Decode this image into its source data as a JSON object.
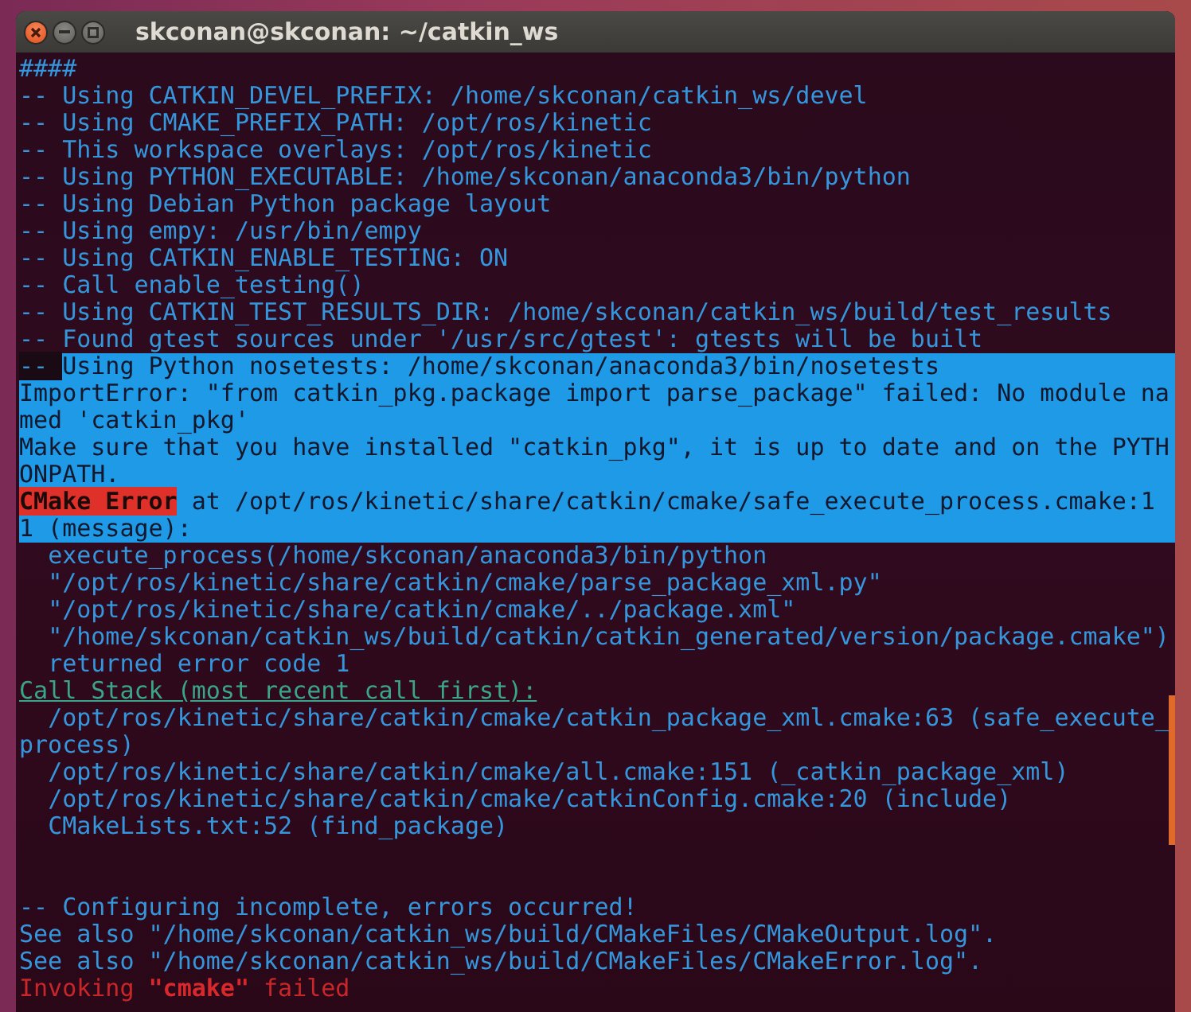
{
  "window": {
    "title": "skconan@skconan: ~/catkin_ws"
  },
  "lines": [
    {
      "selected": false,
      "segments": [
        {
          "text": "####",
          "kind": "info"
        }
      ]
    },
    {
      "selected": false,
      "segments": [
        {
          "text": "-- Using CATKIN_DEVEL_PREFIX: /home/skconan/catkin_ws/devel",
          "kind": "info"
        }
      ]
    },
    {
      "selected": false,
      "segments": [
        {
          "text": "-- Using CMAKE_PREFIX_PATH: /opt/ros/kinetic",
          "kind": "info"
        }
      ]
    },
    {
      "selected": false,
      "segments": [
        {
          "text": "-- This workspace overlays: /opt/ros/kinetic",
          "kind": "info"
        }
      ]
    },
    {
      "selected": false,
      "segments": [
        {
          "text": "-- Using PYTHON_EXECUTABLE: /home/skconan/anaconda3/bin/python",
          "kind": "info"
        }
      ]
    },
    {
      "selected": false,
      "segments": [
        {
          "text": "-- Using Debian Python package layout",
          "kind": "info"
        }
      ]
    },
    {
      "selected": false,
      "segments": [
        {
          "text": "-- Using empy: /usr/bin/empy",
          "kind": "info"
        }
      ]
    },
    {
      "selected": false,
      "segments": [
        {
          "text": "-- Using CATKIN_ENABLE_TESTING: ON",
          "kind": "info"
        }
      ]
    },
    {
      "selected": false,
      "segments": [
        {
          "text": "-- Call enable_testing()",
          "kind": "info"
        }
      ]
    },
    {
      "selected": false,
      "segments": [
        {
          "text": "-- Using CATKIN_TEST_RESULTS_DIR: /home/skconan/catkin_ws/build/test_results",
          "kind": "info"
        }
      ]
    },
    {
      "selected": false,
      "segments": [
        {
          "text": "-- Found gtest sources under '/usr/src/gtest': gtests will be built",
          "kind": "info"
        }
      ]
    },
    {
      "selected": true,
      "segments": [
        {
          "text": "-- ",
          "kind": "cursor"
        },
        {
          "text": "Using Python nosetests: /home/skconan/anaconda3/bin/nosetests",
          "kind": "info"
        }
      ]
    },
    {
      "selected": true,
      "segments": [
        {
          "text": "ImportError: \"from catkin_pkg.package import parse_package\" failed: No module named 'catkin_pkg'",
          "kind": "plain"
        }
      ]
    },
    {
      "selected": true,
      "segments": [
        {
          "text": "Make sure that you have installed \"catkin_pkg\", it is up to date and on the PYTHONPATH.",
          "kind": "plain"
        }
      ]
    },
    {
      "selected": true,
      "segments": [
        {
          "text": "CMake Error",
          "kind": "error_tag"
        },
        {
          "text": " at /opt/ros/kinetic/share/catkin/cmake/safe_execute_process.cmake:11 (message):",
          "kind": "plain"
        }
      ]
    },
    {
      "selected": false,
      "segments": [
        {
          "text": "  execute_process(/home/skconan/anaconda3/bin/python",
          "kind": "info"
        }
      ]
    },
    {
      "selected": false,
      "segments": [
        {
          "text": "  \"/opt/ros/kinetic/share/catkin/cmake/parse_package_xml.py\"",
          "kind": "info"
        }
      ]
    },
    {
      "selected": false,
      "segments": [
        {
          "text": "  \"/opt/ros/kinetic/share/catkin/cmake/../package.xml\"",
          "kind": "info"
        }
      ]
    },
    {
      "selected": false,
      "segments": [
        {
          "text": "  \"/home/skconan/catkin_ws/build/catkin/catkin_generated/version/package.cmake\")",
          "kind": "info"
        }
      ]
    },
    {
      "selected": false,
      "segments": [
        {
          "text": "  returned error code 1",
          "kind": "info"
        }
      ]
    },
    {
      "selected": false,
      "segments": [
        {
          "text": "Call Stack (most recent call first):",
          "kind": "heading"
        }
      ]
    },
    {
      "selected": false,
      "segments": [
        {
          "text": "  /opt/ros/kinetic/share/catkin/cmake/catkin_package_xml.cmake:63 (safe_execute_process)",
          "kind": "info"
        }
      ]
    },
    {
      "selected": false,
      "segments": [
        {
          "text": "  /opt/ros/kinetic/share/catkin/cmake/all.cmake:151 (_catkin_package_xml)",
          "kind": "info"
        }
      ]
    },
    {
      "selected": false,
      "segments": [
        {
          "text": "  /opt/ros/kinetic/share/catkin/cmake/catkinConfig.cmake:20 (include)",
          "kind": "info"
        }
      ]
    },
    {
      "selected": false,
      "segments": [
        {
          "text": "  CMakeLists.txt:52 (find_package)",
          "kind": "info"
        }
      ]
    },
    {
      "selected": false
    },
    {
      "selected": false
    },
    {
      "selected": false,
      "segments": [
        {
          "text": "-- Configuring incomplete, errors occurred!",
          "kind": "info"
        }
      ]
    },
    {
      "selected": false,
      "segments": [
        {
          "text": "See also \"/home/skconan/catkin_ws/build/CMakeFiles/CMakeOutput.log\".",
          "kind": "info"
        }
      ]
    },
    {
      "selected": false,
      "segments": [
        {
          "text": "See also \"/home/skconan/catkin_ws/build/CMakeFiles/CMakeError.log\".",
          "kind": "info"
        }
      ]
    },
    {
      "selected": false,
      "segments": [
        {
          "text": "Invoking ",
          "kind": "fail"
        },
        {
          "text": "\"cmake\"",
          "kind": "fail_bold"
        },
        {
          "text": " failed",
          "kind": "fail"
        }
      ]
    }
  ]
}
